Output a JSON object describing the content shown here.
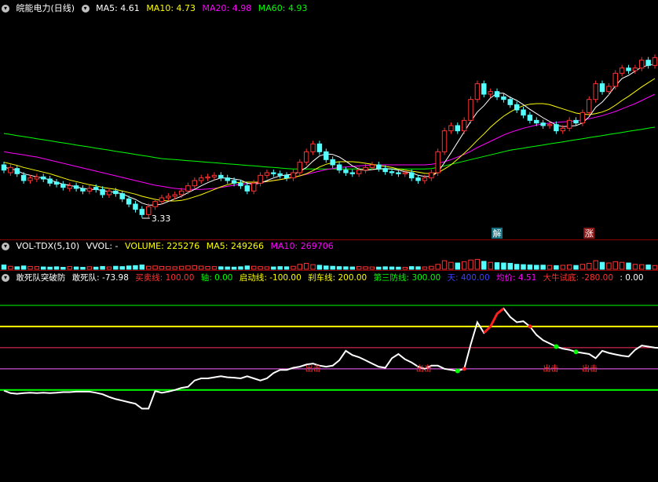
{
  "colors": {
    "bg": "#000000",
    "up": "#ff3232",
    "down": "#54ffff",
    "ma5": "#ffffff",
    "ma10": "#ffff00",
    "ma20": "#ff00ff",
    "ma60": "#00ff00"
  },
  "header1": {
    "title": "皖能电力(日线)",
    "ma5": "MA5: 4.61",
    "ma10": "MA10: 4.73",
    "ma20": "MA20: 4.98",
    "ma60": "MA60: 4.93"
  },
  "header2": {
    "name": "VOL-TDX(5,10)",
    "vvol": "VVOL: -",
    "volume": "VOLUME: 225276",
    "ma5": "MA5: 249266",
    "ma10": "MA10: 269706"
  },
  "header3": {
    "name": "敢死队突破防",
    "dsd": "敢死队: -73.98",
    "buy": "买卖线: 100.00",
    "axis": "轴: 0.00",
    "start": "启动线: -100.00",
    "brake": "刹车线: 200.00",
    "third": "第三防线: 300.00",
    "sky": "天: 400.00",
    "avg": "均价: 4.51",
    "bull": "大牛试底: -280.00",
    "last": ": 0.00"
  },
  "annotations": {
    "low": "3.33",
    "jie": "解",
    "zhang": "涨",
    "chuji": "出击"
  },
  "chart_data": [
    {
      "type": "candlestick",
      "ylim": [
        3.0,
        7.2
      ],
      "close": [
        4.25,
        4.3,
        4.18,
        4.05,
        4.1,
        4.12,
        4.08,
        4.0,
        3.98,
        3.92,
        3.95,
        3.9,
        3.85,
        3.9,
        3.88,
        3.78,
        3.85,
        3.8,
        3.7,
        3.6,
        3.5,
        3.4,
        3.55,
        3.65,
        3.72,
        3.75,
        3.78,
        3.85,
        3.95,
        4.05,
        4.1,
        4.12,
        4.15,
        4.1,
        4.05,
        4.0,
        3.95,
        3.85,
        4.0,
        4.15,
        4.2,
        4.18,
        4.15,
        4.1,
        4.2,
        4.4,
        4.6,
        4.75,
        4.6,
        4.45,
        4.35,
        4.25,
        4.2,
        4.18,
        4.25,
        4.3,
        4.35,
        4.28,
        4.22,
        4.2,
        4.18,
        4.2,
        4.1,
        4.05,
        4.1,
        4.2,
        4.6,
        5.0,
        5.1,
        5.0,
        5.2,
        5.6,
        5.9,
        5.7,
        5.75,
        5.65,
        5.6,
        5.5,
        5.4,
        5.3,
        5.2,
        5.15,
        5.1,
        5.12,
        5.0,
        5.05,
        5.2,
        5.15,
        5.35,
        5.6,
        5.9,
        5.75,
        5.85,
        6.1,
        6.2,
        6.15,
        6.2,
        6.35,
        6.25,
        6.4
      ],
      "open": [
        4.35,
        4.2,
        4.28,
        4.15,
        4.05,
        4.08,
        4.12,
        4.08,
        4.02,
        3.98,
        3.9,
        3.95,
        3.9,
        3.85,
        3.92,
        3.88,
        3.78,
        3.85,
        3.8,
        3.7,
        3.6,
        3.5,
        3.4,
        3.55,
        3.65,
        3.72,
        3.75,
        3.78,
        3.85,
        3.95,
        4.05,
        4.1,
        4.12,
        4.15,
        4.1,
        4.05,
        4.0,
        3.95,
        3.85,
        4.0,
        4.15,
        4.2,
        4.18,
        4.15,
        4.1,
        4.2,
        4.4,
        4.6,
        4.75,
        4.6,
        4.45,
        4.35,
        4.25,
        4.2,
        4.18,
        4.25,
        4.3,
        4.35,
        4.28,
        4.22,
        4.2,
        4.18,
        4.2,
        4.1,
        4.05,
        4.1,
        4.2,
        4.6,
        5.0,
        5.1,
        5.0,
        5.2,
        5.6,
        5.9,
        5.7,
        5.75,
        5.65,
        5.6,
        5.5,
        5.4,
        5.3,
        5.2,
        5.15,
        5.1,
        5.12,
        5.0,
        5.05,
        5.2,
        5.15,
        5.35,
        5.6,
        5.9,
        5.75,
        5.85,
        6.1,
        6.2,
        6.15,
        6.2,
        6.35,
        6.25
      ],
      "ma5": [
        4.3,
        4.28,
        4.24,
        4.18,
        4.15,
        4.12,
        4.1,
        4.06,
        4.02,
        3.98,
        3.96,
        3.93,
        3.9,
        3.88,
        3.88,
        3.86,
        3.84,
        3.82,
        3.8,
        3.74,
        3.69,
        3.62,
        3.58,
        3.58,
        3.6,
        3.65,
        3.7,
        3.75,
        3.82,
        3.88,
        3.95,
        4.01,
        4.06,
        4.1,
        4.1,
        4.08,
        4.06,
        4.0,
        3.98,
        4.0,
        4.05,
        4.1,
        4.14,
        4.16,
        4.17,
        4.22,
        4.3,
        4.42,
        4.52,
        4.56,
        4.55,
        4.5,
        4.42,
        4.33,
        4.27,
        4.24,
        4.26,
        4.27,
        4.28,
        4.27,
        4.25,
        4.22,
        4.2,
        4.15,
        4.13,
        4.13,
        4.21,
        4.39,
        4.58,
        4.78,
        4.98,
        5.18,
        5.36,
        5.48,
        5.63,
        5.72,
        5.72,
        5.64,
        5.58,
        5.5,
        5.41,
        5.33,
        5.25,
        5.18,
        5.11,
        5.08,
        5.09,
        5.1,
        5.15,
        5.27,
        5.45,
        5.55,
        5.69,
        5.86,
        6.0,
        6.06,
        6.14,
        6.22,
        6.25,
        6.28
      ],
      "ma10": [
        4.4,
        4.37,
        4.34,
        4.3,
        4.27,
        4.24,
        4.21,
        4.18,
        4.14,
        4.1,
        4.06,
        4.03,
        4.0,
        3.97,
        3.95,
        3.92,
        3.9,
        3.88,
        3.85,
        3.82,
        3.79,
        3.75,
        3.72,
        3.69,
        3.67,
        3.66,
        3.66,
        3.67,
        3.7,
        3.74,
        3.78,
        3.83,
        3.88,
        3.93,
        3.97,
        4.0,
        4.02,
        4.02,
        4.02,
        4.02,
        4.03,
        4.05,
        4.07,
        4.09,
        4.11,
        4.14,
        4.18,
        4.24,
        4.31,
        4.36,
        4.39,
        4.41,
        4.41,
        4.41,
        4.4,
        4.38,
        4.36,
        4.34,
        4.32,
        4.3,
        4.27,
        4.25,
        4.23,
        4.21,
        4.19,
        4.18,
        4.2,
        4.27,
        4.35,
        4.46,
        4.57,
        4.69,
        4.82,
        4.94,
        5.07,
        5.18,
        5.28,
        5.36,
        5.43,
        5.48,
        5.51,
        5.52,
        5.52,
        5.5,
        5.46,
        5.42,
        5.38,
        5.34,
        5.32,
        5.31,
        5.33,
        5.36,
        5.41,
        5.49,
        5.58,
        5.66,
        5.75,
        5.84,
        5.92,
        6.0
      ],
      "ma20": [
        4.6,
        4.58,
        4.56,
        4.54,
        4.52,
        4.5,
        4.47,
        4.44,
        4.41,
        4.38,
        4.35,
        4.32,
        4.29,
        4.26,
        4.23,
        4.2,
        4.17,
        4.14,
        4.11,
        4.08,
        4.05,
        4.02,
        3.99,
        3.96,
        3.94,
        3.92,
        3.9,
        3.89,
        3.88,
        3.88,
        3.88,
        3.89,
        3.9,
        3.92,
        3.94,
        3.96,
        3.98,
        3.99,
        4.0,
        4.01,
        4.03,
        4.05,
        4.07,
        4.09,
        4.11,
        4.14,
        4.17,
        4.2,
        4.23,
        4.26,
        4.28,
        4.3,
        4.31,
        4.32,
        4.33,
        4.34,
        4.35,
        4.35,
        4.35,
        4.35,
        4.35,
        4.35,
        4.35,
        4.35,
        4.35,
        4.36,
        4.38,
        4.41,
        4.45,
        4.5,
        4.55,
        4.61,
        4.68,
        4.74,
        4.8,
        4.86,
        4.92,
        4.97,
        5.01,
        5.05,
        5.08,
        5.11,
        5.13,
        5.15,
        5.16,
        5.17,
        5.18,
        5.19,
        5.21,
        5.23,
        5.26,
        5.29,
        5.33,
        5.37,
        5.42,
        5.47,
        5.52,
        5.58,
        5.64,
        5.7
      ],
      "ma60": [
        4.95,
        4.93,
        4.91,
        4.89,
        4.87,
        4.85,
        4.83,
        4.81,
        4.79,
        4.77,
        4.75,
        4.73,
        4.71,
        4.69,
        4.67,
        4.65,
        4.63,
        4.61,
        4.59,
        4.57,
        4.55,
        4.53,
        4.51,
        4.49,
        4.47,
        4.46,
        4.45,
        4.44,
        4.43,
        4.42,
        4.41,
        4.4,
        4.39,
        4.38,
        4.37,
        4.36,
        4.35,
        4.34,
        4.33,
        4.32,
        4.31,
        4.3,
        4.29,
        4.28,
        4.27,
        4.27,
        4.27,
        4.27,
        4.27,
        4.27,
        4.27,
        4.27,
        4.27,
        4.27,
        4.27,
        4.27,
        4.27,
        4.27,
        4.27,
        4.27,
        4.27,
        4.27,
        4.27,
        4.27,
        4.27,
        4.28,
        4.3,
        4.33,
        4.36,
        4.39,
        4.42,
        4.45,
        4.48,
        4.51,
        4.54,
        4.57,
        4.6,
        4.63,
        4.65,
        4.67,
        4.69,
        4.71,
        4.73,
        4.75,
        4.77,
        4.79,
        4.81,
        4.83,
        4.85,
        4.87,
        4.89,
        4.91,
        4.93,
        4.95,
        4.97,
        4.99,
        5.01,
        5.03,
        5.05,
        5.07
      ],
      "low_value": 3.33
    },
    {
      "type": "bar",
      "ylim": [
        0,
        1000000
      ],
      "values": [
        260000,
        180000,
        150000,
        200000,
        170000,
        160000,
        140000,
        130000,
        150000,
        120000,
        160000,
        140000,
        120000,
        150000,
        130000,
        170000,
        140000,
        180000,
        160000,
        200000,
        220000,
        260000,
        180000,
        200000,
        170000,
        160000,
        150000,
        180000,
        200000,
        220000,
        190000,
        170000,
        160000,
        150000,
        140000,
        130000,
        150000,
        200000,
        180000,
        160000,
        150000,
        140000,
        160000,
        150000,
        180000,
        300000,
        360000,
        280000,
        240000,
        200000,
        180000,
        160000,
        150000,
        140000,
        160000,
        150000,
        140000,
        130000,
        150000,
        140000,
        130000,
        120000,
        160000,
        150000,
        140000,
        180000,
        300000,
        520000,
        420000,
        380000,
        460000,
        560000,
        600000,
        480000,
        420000,
        400000,
        380000,
        360000,
        300000,
        280000,
        260000,
        240000,
        250000,
        230000,
        220000,
        240000,
        260000,
        230000,
        300000,
        360000,
        520000,
        420000,
        380000,
        460000,
        420000,
        380000,
        300000,
        280000,
        260000,
        225276
      ]
    },
    {
      "type": "line",
      "ylim": [
        -420,
        500
      ],
      "levels": [
        {
          "name": "天",
          "value": 400,
          "color": "#00ff00"
        },
        {
          "name": "第三防线",
          "value": 300,
          "color": "#ffff00"
        },
        {
          "name": "刹车线",
          "value": 200,
          "color": "#ff3060"
        },
        {
          "name": "买卖线",
          "value": 100,
          "color": "#ff66ff"
        },
        {
          "name": "轴",
          "value": 0,
          "color": "#00ff00"
        }
      ],
      "values": [
        -3,
        -15,
        -18,
        -15,
        -13,
        -15,
        -13,
        -15,
        -13,
        -10,
        -10,
        -8,
        -8,
        -8,
        -13,
        -20,
        -33,
        -43,
        -50,
        -58,
        -65,
        -88,
        -88,
        -5,
        -13,
        -8,
        0,
        10,
        15,
        45,
        55,
        55,
        60,
        65,
        60,
        58,
        55,
        65,
        55,
        45,
        55,
        80,
        95,
        95,
        105,
        110,
        120,
        125,
        115,
        110,
        115,
        140,
        185,
        165,
        155,
        140,
        125,
        110,
        105,
        150,
        170,
        145,
        130,
        110,
        100,
        115,
        115,
        100,
        95,
        90,
        100,
        215,
        320,
        270,
        300,
        360,
        385,
        345,
        320,
        325,
        300,
        260,
        235,
        220,
        205,
        195,
        190,
        180,
        175,
        170,
        150,
        185,
        175,
        168,
        162,
        158,
        190,
        210,
        205,
        200,
        198,
        185
      ]
    }
  ]
}
